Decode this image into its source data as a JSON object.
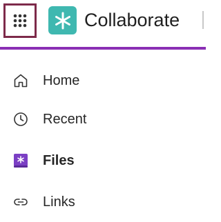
{
  "header": {
    "app_name": "Collaborate",
    "launcher_icon": "grid-dots-icon",
    "logo_icon": "asterisk-logo"
  },
  "colors": {
    "accent": "#8a2fb4",
    "logo_bg": "#3fb8b0",
    "launcher_border": "#7d2a4a",
    "active_icon": "#7b3fc4"
  },
  "nav": {
    "items": [
      {
        "label": "Home",
        "icon": "home-icon",
        "active": false
      },
      {
        "label": "Recent",
        "icon": "clock-icon",
        "active": false
      },
      {
        "label": "Files",
        "icon": "files-icon",
        "active": true
      },
      {
        "label": "Links",
        "icon": "link-icon",
        "active": false
      }
    ]
  }
}
